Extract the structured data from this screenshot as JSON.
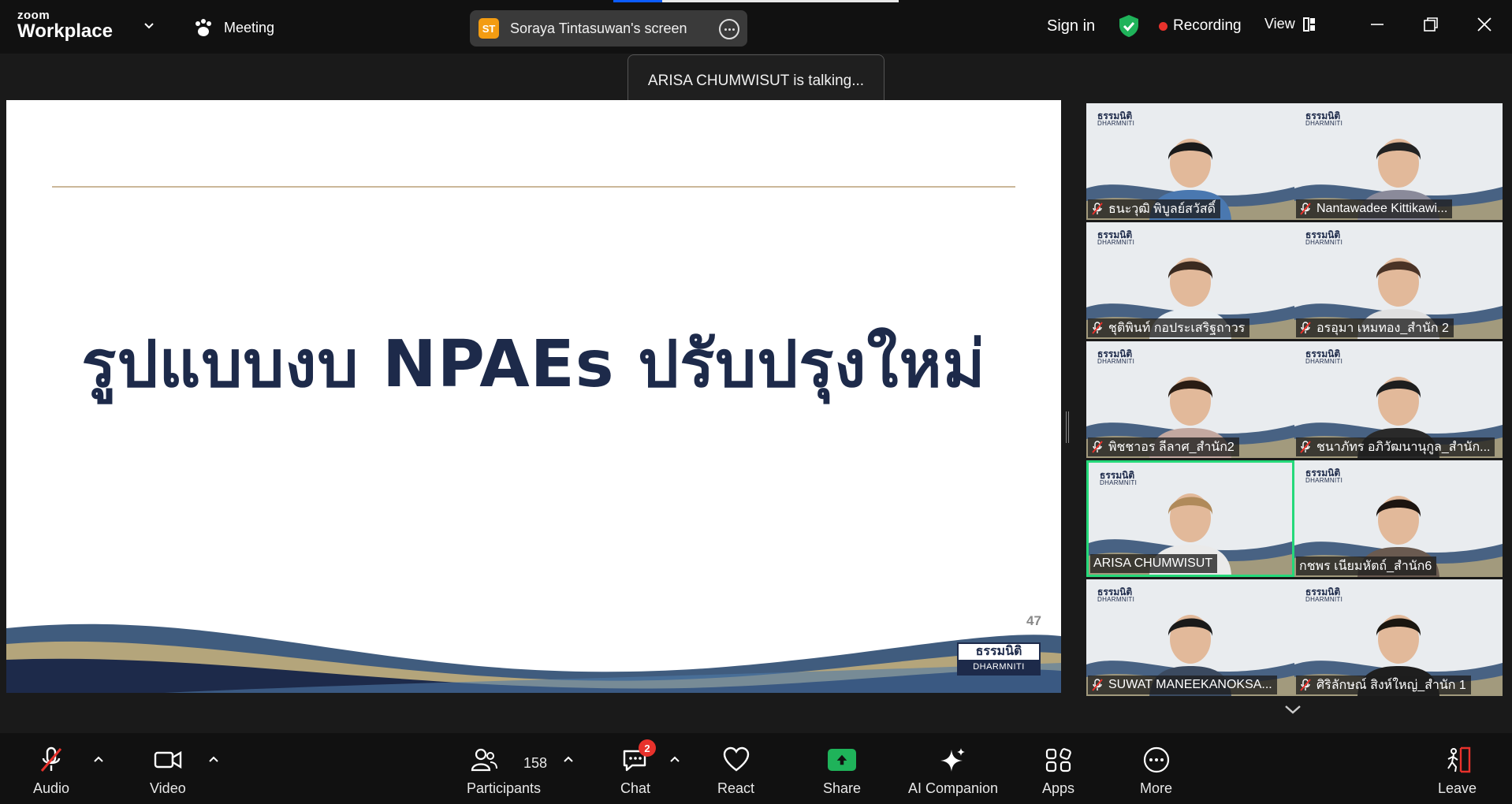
{
  "topbar": {
    "brand_line1": "zoom",
    "brand_line2": "Workplace",
    "meeting_label": "Meeting",
    "share": {
      "initials": "ST",
      "label": "Soraya Tintasuwan's screen",
      "progress_fraction": 0.17
    },
    "signin_label": "Sign in",
    "recording_label": "Recording",
    "view_label": "View"
  },
  "toast": {
    "text": "ARISA CHUMWISUT is talking..."
  },
  "slide": {
    "title": "รูปแบบงบ NPAEs ปรับปรุงใหม่",
    "page_number": "47",
    "logo_th": "ธรรมนิติ",
    "logo_en": "DHARMNITI"
  },
  "gallery": {
    "tile_brand_th": "ธรรมนิติ",
    "tile_brand_en": "DHARMNITI",
    "participants": [
      {
        "name": "ธนะวุฒิ พิบูลย์สวัสดิ์",
        "muted": true
      },
      {
        "name": "Nantawadee Kittikawi...",
        "muted": true
      },
      {
        "name": "ชุติพินท์ กอประเสริฐถาวร",
        "muted": true
      },
      {
        "name": "อรอุมา เหมทอง_สำนัก 2",
        "muted": true
      },
      {
        "name": "พิชชาอร ลีลาศ_สำนัก2",
        "muted": true
      },
      {
        "name": "ชนาภัทร อภิวัฒนานุกูล_สำนัก...",
        "muted": true
      },
      {
        "name": "ARISA CHUMWISUT",
        "muted": false,
        "active": true
      },
      {
        "name": "กชพร เนียมหัตถ์_สำนัก6",
        "muted": false
      },
      {
        "name": "SUWAT MANEEKANOKSA...",
        "muted": true
      },
      {
        "name": "ศิริลักษณ์  สิงห์ใหญ่_สำนัก 1",
        "muted": true
      }
    ]
  },
  "toolbar": {
    "audio": "Audio",
    "video": "Video",
    "participants": "Participants",
    "participants_count": "158",
    "chat": "Chat",
    "chat_badge": "2",
    "react": "React",
    "share": "Share",
    "ai_companion": "AI Companion",
    "apps": "Apps",
    "more": "More",
    "leave": "Leave"
  },
  "colors": {
    "accent_green": "#25d97a",
    "share_green": "#1fb35a",
    "record_red": "#e8322c",
    "slide_navy": "#1d2a4a",
    "shield_green": "#1fb35a",
    "zoom_blue": "#0b5cff"
  }
}
